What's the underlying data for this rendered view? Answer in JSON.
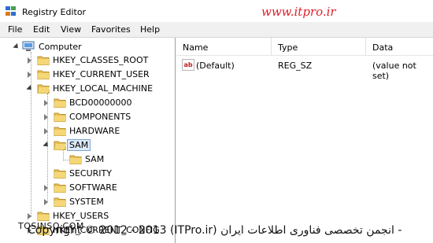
{
  "window": {
    "title": "Registry Editor"
  },
  "watermark": {
    "top": "www.itpro.ir",
    "bottom_left": "TOSINSO.COM",
    "bottom": "Copyright © 2012 - 2013 (ITPro.ir) انجمن تخصصی فناوری اطلاعات ایران -"
  },
  "menu": [
    "File",
    "Edit",
    "View",
    "Favorites",
    "Help"
  ],
  "tree": {
    "root": "Computer",
    "nodes": [
      {
        "label": "HKEY_CLASSES_ROOT",
        "expanded": false
      },
      {
        "label": "HKEY_CURRENT_USER",
        "expanded": false
      },
      {
        "label": "HKEY_LOCAL_MACHINE",
        "expanded": true
      },
      {
        "label": "BCD00000000",
        "expanded": false
      },
      {
        "label": "COMPONENTS",
        "expanded": false
      },
      {
        "label": "HARDWARE",
        "expanded": false
      },
      {
        "label": "SAM",
        "expanded": true,
        "selected": true
      },
      {
        "label": "SAM",
        "expanded": false
      },
      {
        "label": "SECURITY",
        "expanded": false
      },
      {
        "label": "SOFTWARE",
        "expanded": false
      },
      {
        "label": "SYSTEM",
        "expanded": false
      },
      {
        "label": "HKEY_USERS",
        "expanded": false
      },
      {
        "label": "HKEY_CURRENT_CONFIG",
        "expanded": false
      }
    ]
  },
  "list": {
    "columns": [
      "Name",
      "Type",
      "Data"
    ],
    "rows": [
      {
        "icon": "ab",
        "name": "(Default)",
        "type": "REG_SZ",
        "data": "(value not set)"
      }
    ]
  }
}
